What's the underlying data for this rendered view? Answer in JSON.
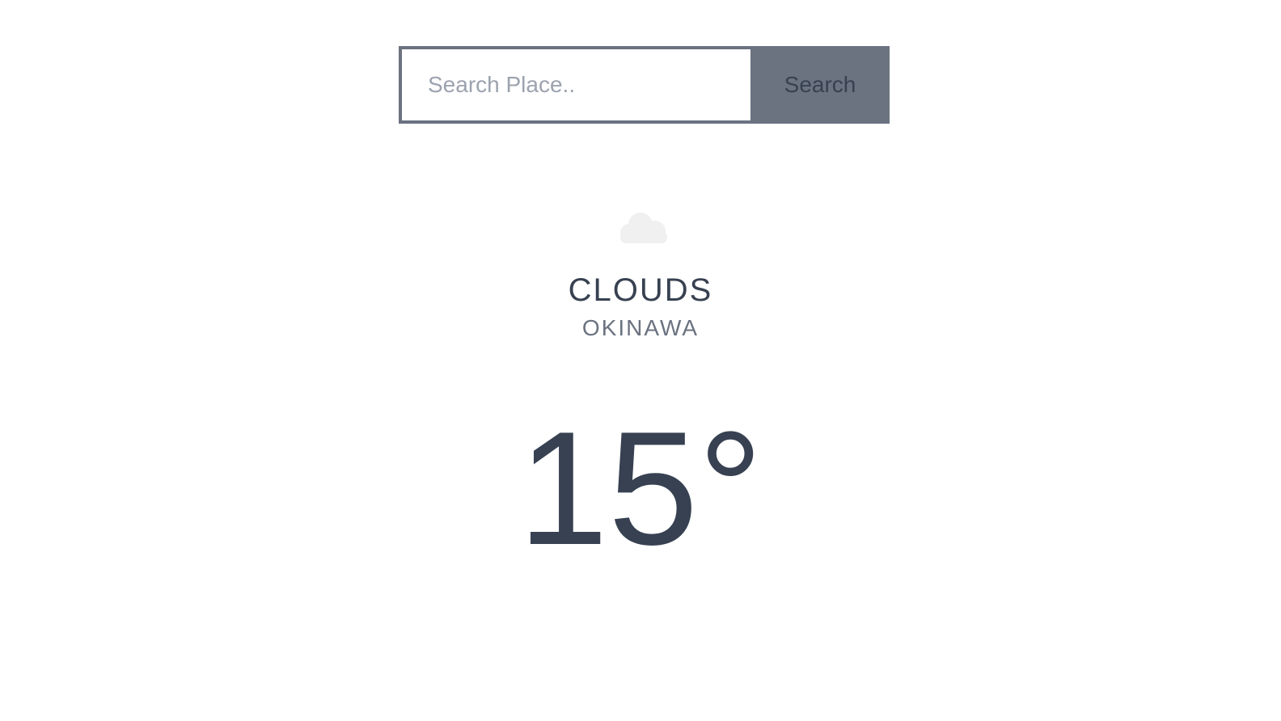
{
  "search": {
    "placeholder": "Search Place..",
    "value": "",
    "button_label": "Search"
  },
  "weather": {
    "icon": "cloud-icon",
    "condition": "CLOUDS",
    "place": "OKINAWA",
    "temperature": "15°"
  },
  "colors": {
    "button_bg": "#6b7280",
    "text_dark": "#374151",
    "text_muted": "#6b7280",
    "icon": "#f0f0f0"
  }
}
